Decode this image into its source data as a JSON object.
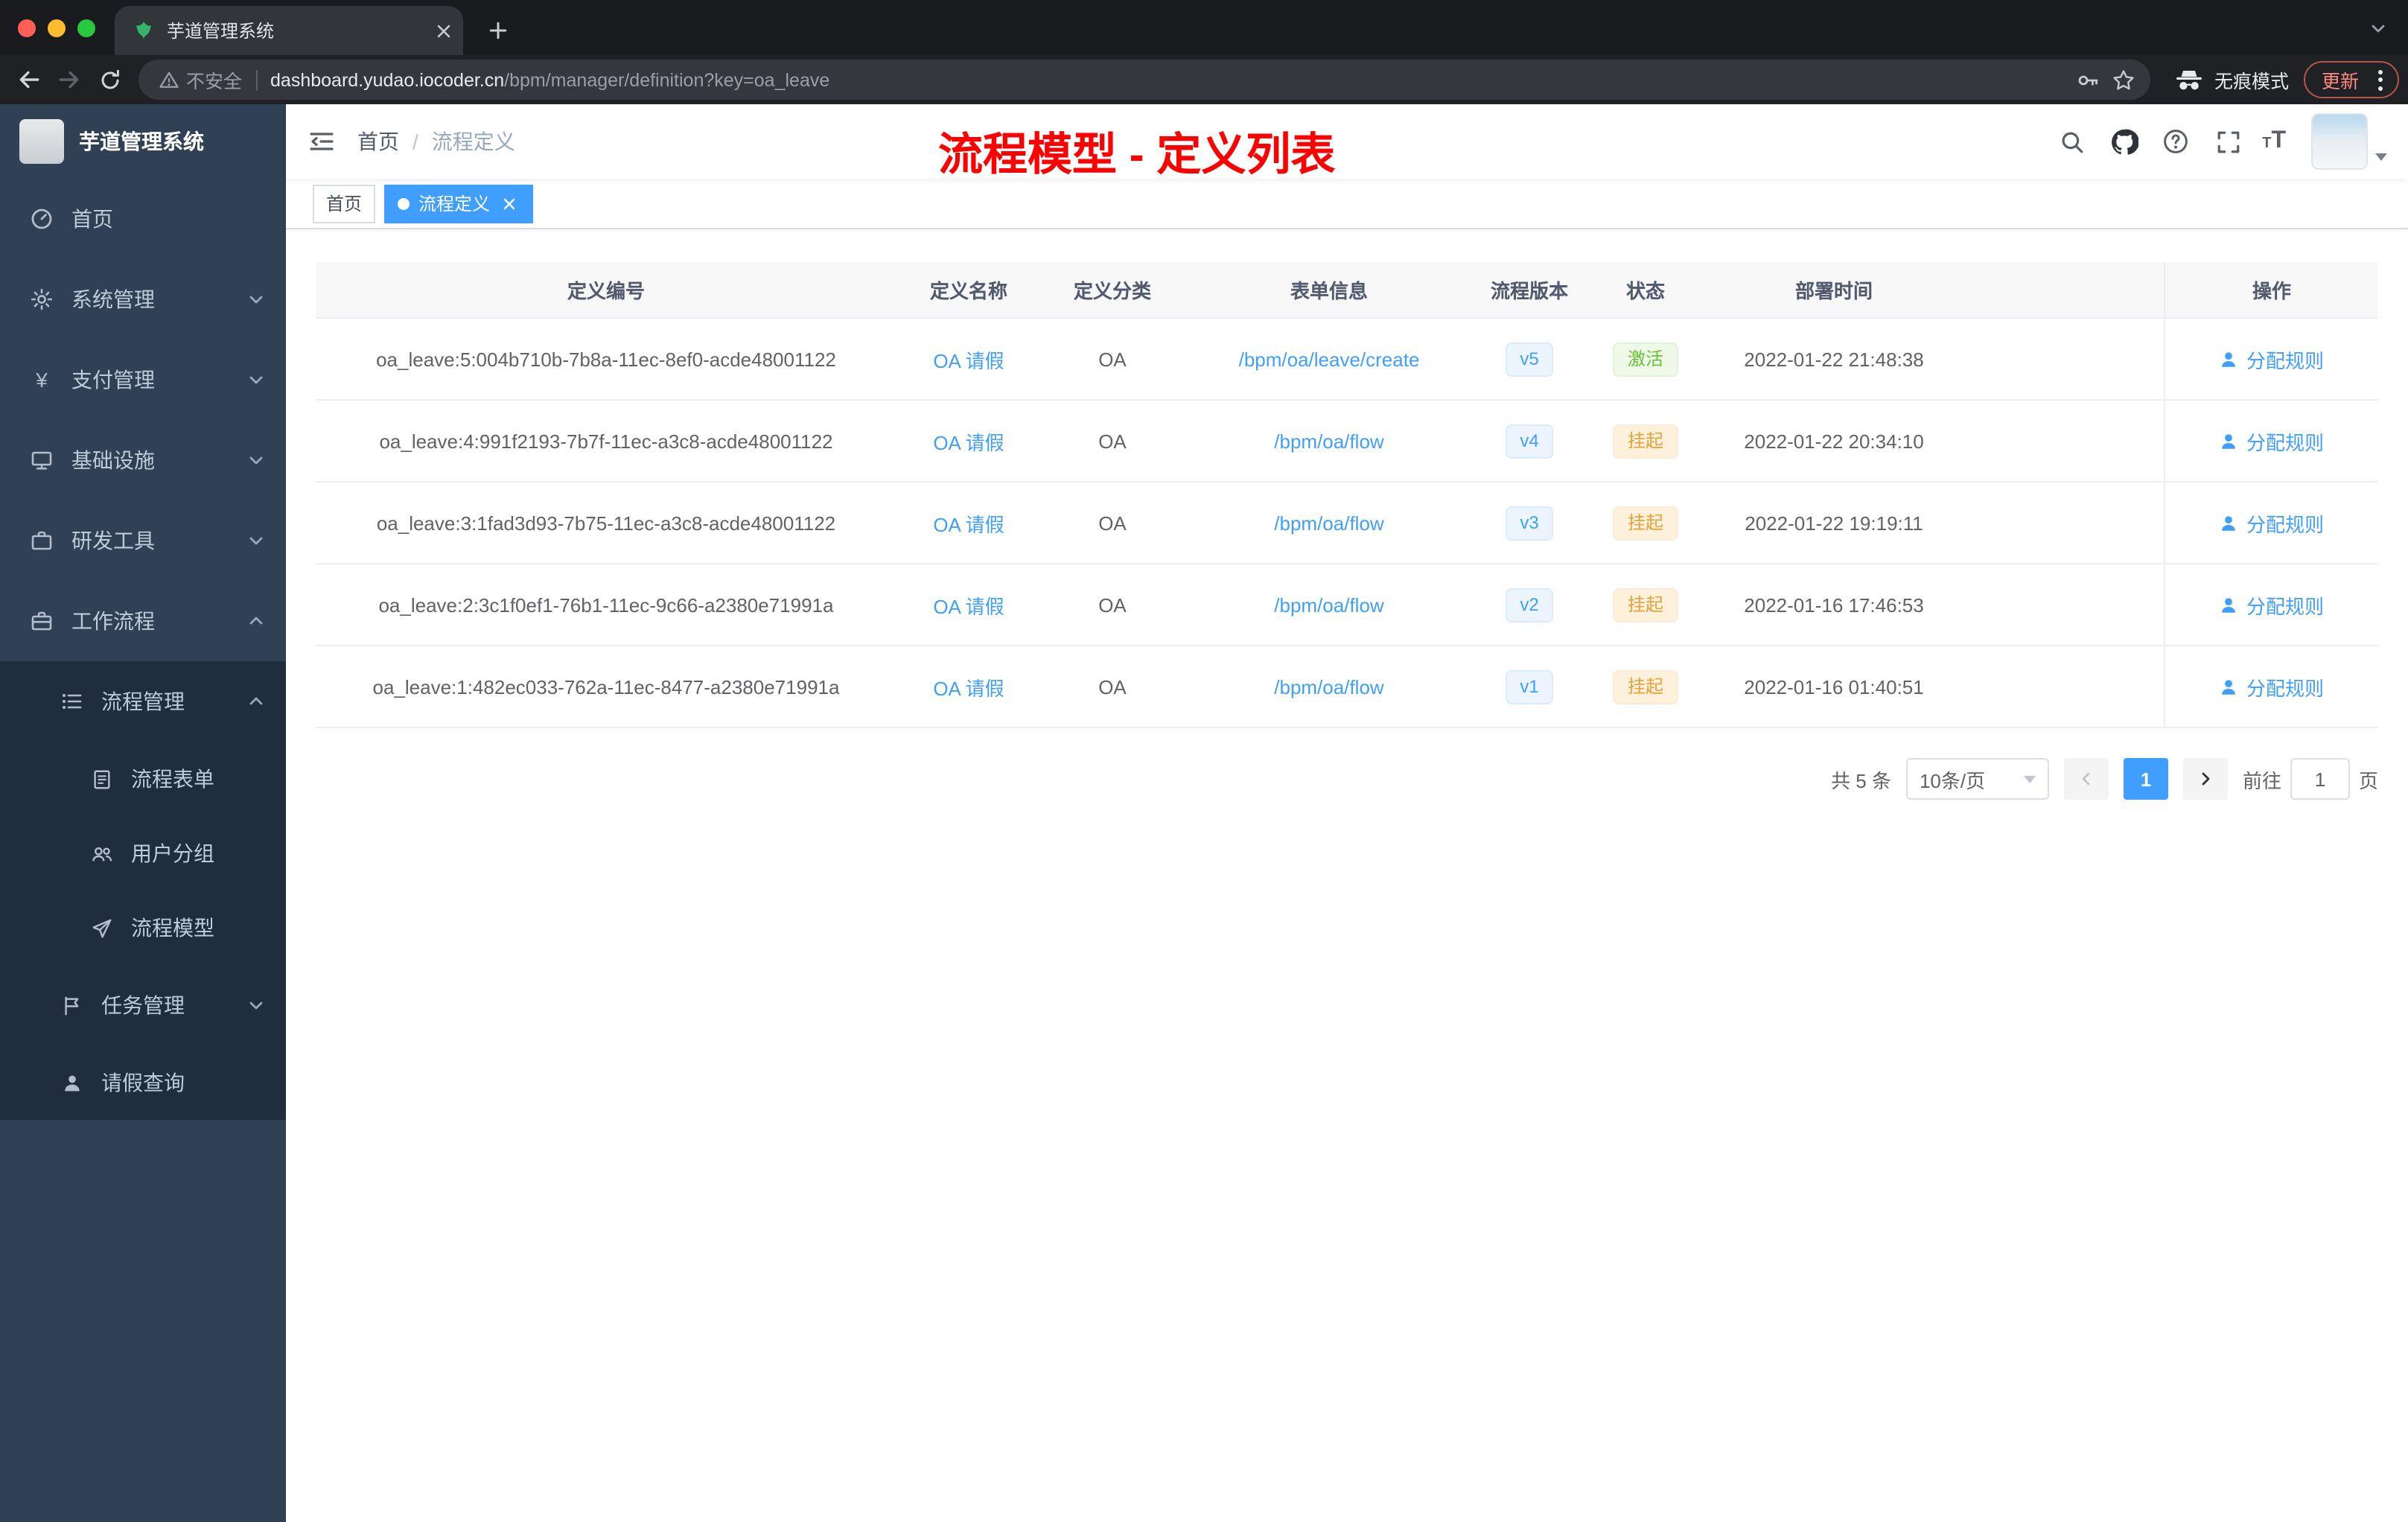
{
  "browser": {
    "tab_title": "芋道管理系统",
    "security_label": "不安全",
    "url_domain": "dashboard.yudao.iocoder.cn",
    "url_path": "/bpm/manager/definition?key=oa_leave",
    "incognito_label": "无痕模式",
    "update_label": "更新"
  },
  "icons": {
    "yen": "¥",
    "t_small": "T",
    "t_big": "T"
  },
  "sidebar": {
    "app_title": "芋道管理系统",
    "items": {
      "home": "首页",
      "system": "系统管理",
      "payment": "支付管理",
      "infra": "基础设施",
      "devtools": "研发工具",
      "workflow": "工作流程",
      "process_mgmt": "流程管理",
      "process_form": "流程表单",
      "user_group": "用户分组",
      "process_model": "流程模型",
      "task_mgmt": "任务管理",
      "leave_query": "请假查询"
    }
  },
  "header": {
    "breadcrumb_home": "首页",
    "breadcrumb_separator": "/",
    "breadcrumb_current": "流程定义",
    "annotation": "流程模型 - 定义列表"
  },
  "tags": [
    {
      "label": "首页",
      "active": false
    },
    {
      "label": "流程定义",
      "active": true
    }
  ],
  "table": {
    "columns": [
      "定义编号",
      "定义名称",
      "定义分类",
      "表单信息",
      "流程版本",
      "状态",
      "部署时间",
      "操作"
    ],
    "action_label": "分配规则",
    "rows": [
      {
        "id": "oa_leave:5:004b710b-7b8a-11ec-8ef0-acde48001122",
        "name": "OA 请假",
        "category": "OA",
        "form": "/bpm/oa/leave/create",
        "version": "v5",
        "status": "激活",
        "status_type": "success",
        "deploy_time": "2022-01-22 21:48:38"
      },
      {
        "id": "oa_leave:4:991f2193-7b7f-11ec-a3c8-acde48001122",
        "name": "OA 请假",
        "category": "OA",
        "form": "/bpm/oa/flow",
        "version": "v4",
        "status": "挂起",
        "status_type": "warning",
        "deploy_time": "2022-01-22 20:34:10"
      },
      {
        "id": "oa_leave:3:1fad3d93-7b75-11ec-a3c8-acde48001122",
        "name": "OA 请假",
        "category": "OA",
        "form": "/bpm/oa/flow",
        "version": "v3",
        "status": "挂起",
        "status_type": "warning",
        "deploy_time": "2022-01-22 19:19:11"
      },
      {
        "id": "oa_leave:2:3c1f0ef1-76b1-11ec-9c66-a2380e71991a",
        "name": "OA 请假",
        "category": "OA",
        "form": "/bpm/oa/flow",
        "version": "v2",
        "status": "挂起",
        "status_type": "warning",
        "deploy_time": "2022-01-16 17:46:53"
      },
      {
        "id": "oa_leave:1:482ec033-762a-11ec-8477-a2380e71991a",
        "name": "OA 请假",
        "category": "OA",
        "form": "/bpm/oa/flow",
        "version": "v1",
        "status": "挂起",
        "status_type": "warning",
        "deploy_time": "2022-01-16 01:40:51"
      }
    ]
  },
  "pagination": {
    "total": "共 5 条",
    "page_size": "10条/页",
    "current_page": "1",
    "goto_label": "前往",
    "goto_value": "1",
    "page_unit": "页"
  },
  "colors": {
    "accent": "#409eff",
    "success": "#67c23a",
    "warning": "#e6a23c",
    "annotation": "#fe0000",
    "sidebar_bg": "#304156",
    "submenu_bg": "#1f2d3d"
  }
}
